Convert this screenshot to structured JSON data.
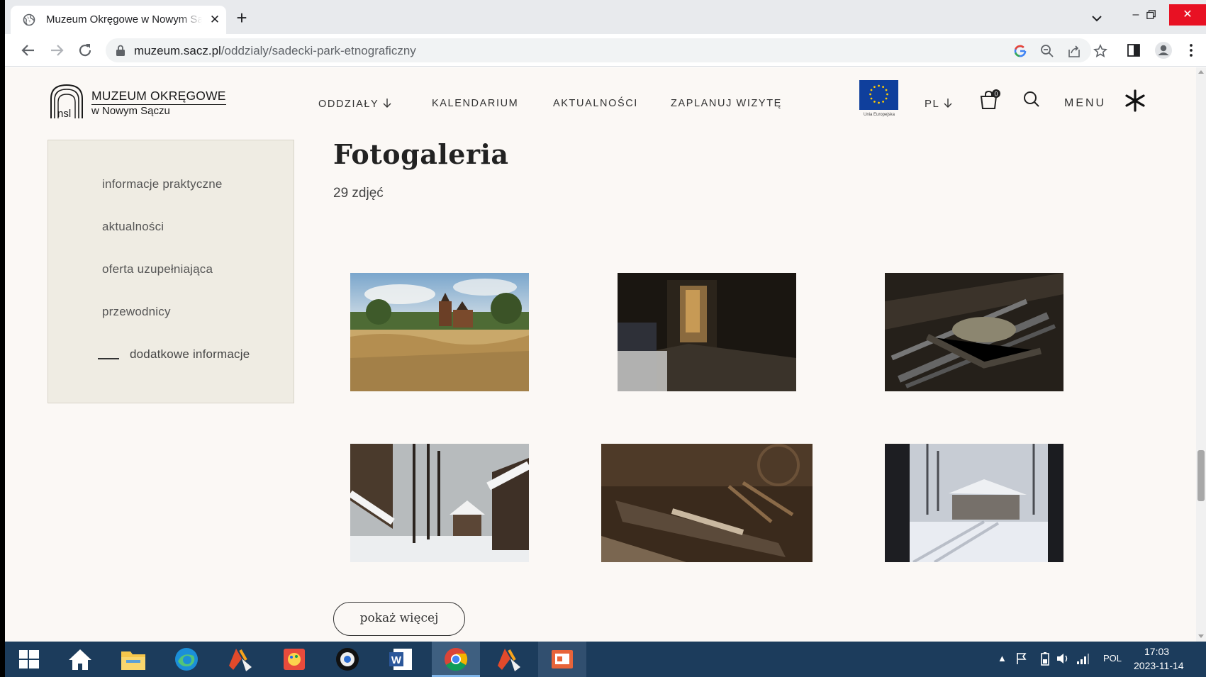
{
  "browser": {
    "tab_title": "Muzeum Okręgowe w Nowym Sącz",
    "url_host": "muzeum.sacz.pl",
    "url_path": "/oddzialy/sadecki-park-etnograficzny"
  },
  "site": {
    "logo_line1": "MUZEUM OKRĘGOWE",
    "logo_line2": "w Nowym Sączu",
    "nav": [
      "ODDZIAŁY",
      "KALENDARIUM",
      "AKTUALNOŚCI",
      "ZAPLANUJ WIZYTĘ"
    ],
    "eu_label": "Unia Europejska",
    "lang": "PL",
    "cart_count": "0",
    "menu_label": "MENU"
  },
  "sidebar": {
    "items": [
      "informacje praktyczne",
      "aktualności",
      "oferta uzupełniająca",
      "przewodnicy",
      "dodatkowe informacje"
    ],
    "active_index": 4
  },
  "gallery": {
    "title": "Fotogaleria",
    "count": "29 zdjęć",
    "more_label": "pokaż więcej"
  },
  "taskbar": {
    "lang": "POL",
    "time": "17:03",
    "date": "2023-11-14"
  },
  "colors": {
    "page_bg": "#fbf8f5",
    "sidebar_bg": "#efece3",
    "taskbar_bg": "#1c3c5c",
    "close_red": "#e81123"
  }
}
